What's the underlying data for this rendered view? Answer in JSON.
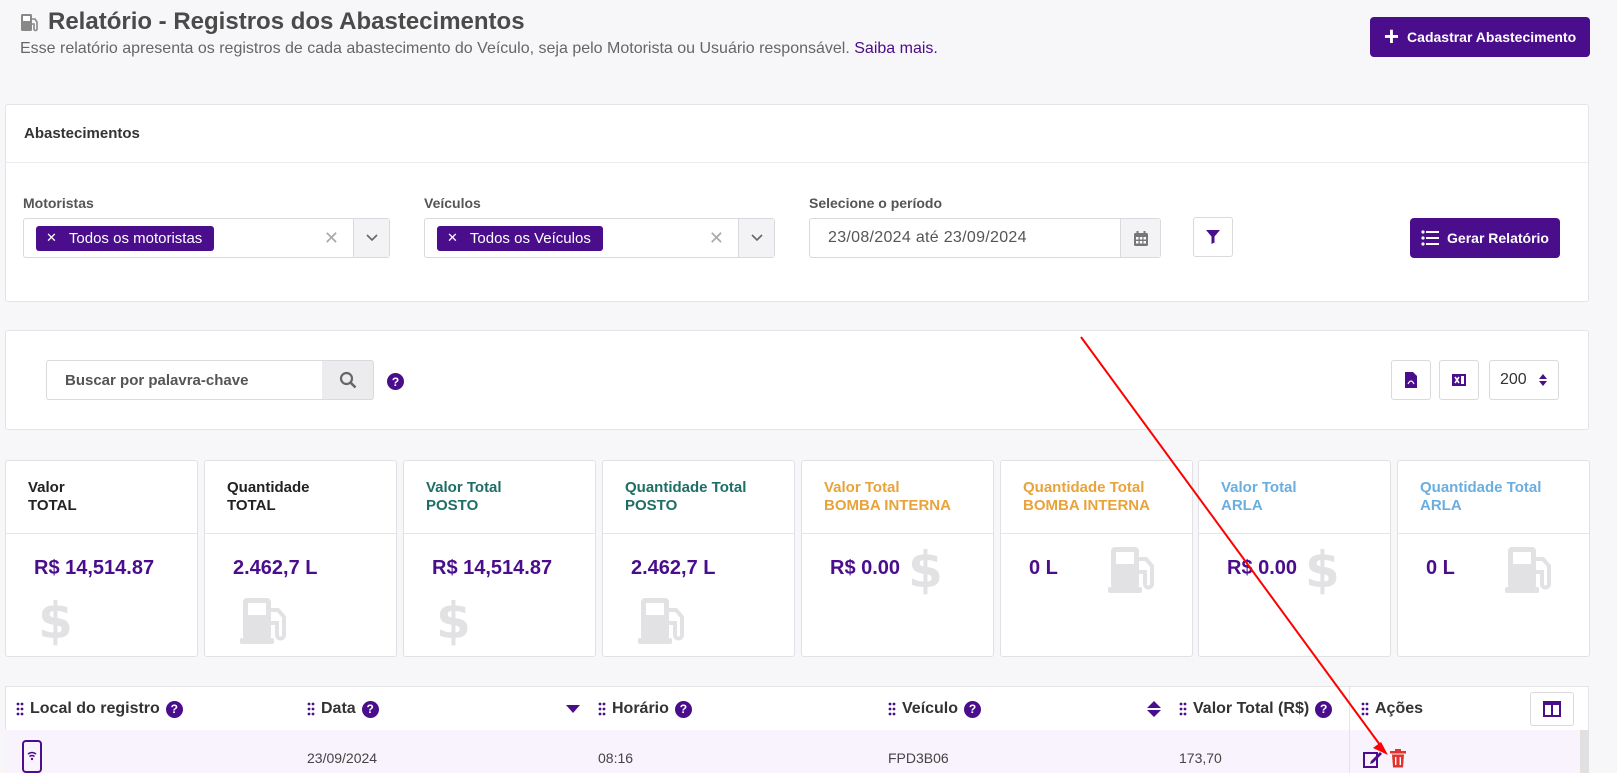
{
  "header": {
    "title": "Relatório - Registros dos Abastecimentos",
    "subtitle": "Esse relatório apresenta os registros de cada abastecimento do Veículo, seja pelo Motorista ou Usuário responsável.",
    "subtitle_link": "Saiba mais.",
    "add_button": "Cadastrar Abastecimento",
    "title_icon": "fuel-pump-icon"
  },
  "filters": {
    "card_title": "Abastecimentos",
    "motoristas": {
      "label": "Motoristas",
      "chip": "Todos os motoristas"
    },
    "veiculos": {
      "label": "Veículos",
      "chip": "Todos os Veículos"
    },
    "periodo": {
      "label": "Selecione o período",
      "start": "23/08/2024",
      "sep": "até",
      "end": "23/09/2024"
    },
    "generate_button": "Gerar Relatório"
  },
  "search": {
    "placeholder": "Buscar por palavra-chave",
    "page_size": "200"
  },
  "stats": [
    {
      "line1": "Valor",
      "line2": "TOTAL",
      "value": "R$ 14,514.87",
      "icon": "dollar-icon"
    },
    {
      "line1": "Quantidade",
      "line2": "TOTAL",
      "value": "2.462,7 L",
      "icon": "fuel-pump-icon"
    },
    {
      "line1": "Valor Total",
      "line2": "POSTO",
      "value": "R$ 14,514.87",
      "icon": "dollar-icon"
    },
    {
      "line1": "Quantidade Total",
      "line2": "POSTO",
      "value": "2.462,7 L",
      "icon": "fuel-pump-icon"
    },
    {
      "line1": "Valor Total",
      "line2": "BOMBA INTERNA",
      "value": "R$ 0.00",
      "icon": "dollar-icon"
    },
    {
      "line1": "Quantidade Total",
      "line2": "BOMBA INTERNA",
      "value": "0 L",
      "icon": "fuel-pump-icon"
    },
    {
      "line1": "Valor Total",
      "line2": "ARLA",
      "value": "R$ 0.00",
      "icon": "dollar-icon"
    },
    {
      "line1": "Quantidade Total",
      "line2": "ARLA",
      "value": "0 L",
      "icon": "fuel-pump-icon"
    }
  ],
  "table": {
    "columns": [
      "Local do registro",
      "Data",
      "Horário",
      "Veículo",
      "Valor Total (R$)",
      "Ações"
    ],
    "rows": [
      {
        "local_icon": "mobile-phone-icon",
        "data": "23/09/2024",
        "horario": "08:16",
        "veiculo": "FPD3B06",
        "valor": "173,70"
      }
    ]
  },
  "colors": {
    "primary": "#4a0d8c",
    "green": "#1f6e66",
    "orange": "#e8a33a",
    "blue": "#6aaee0",
    "delete": "#e0342f",
    "annotation_arrow": "#ff0000"
  }
}
